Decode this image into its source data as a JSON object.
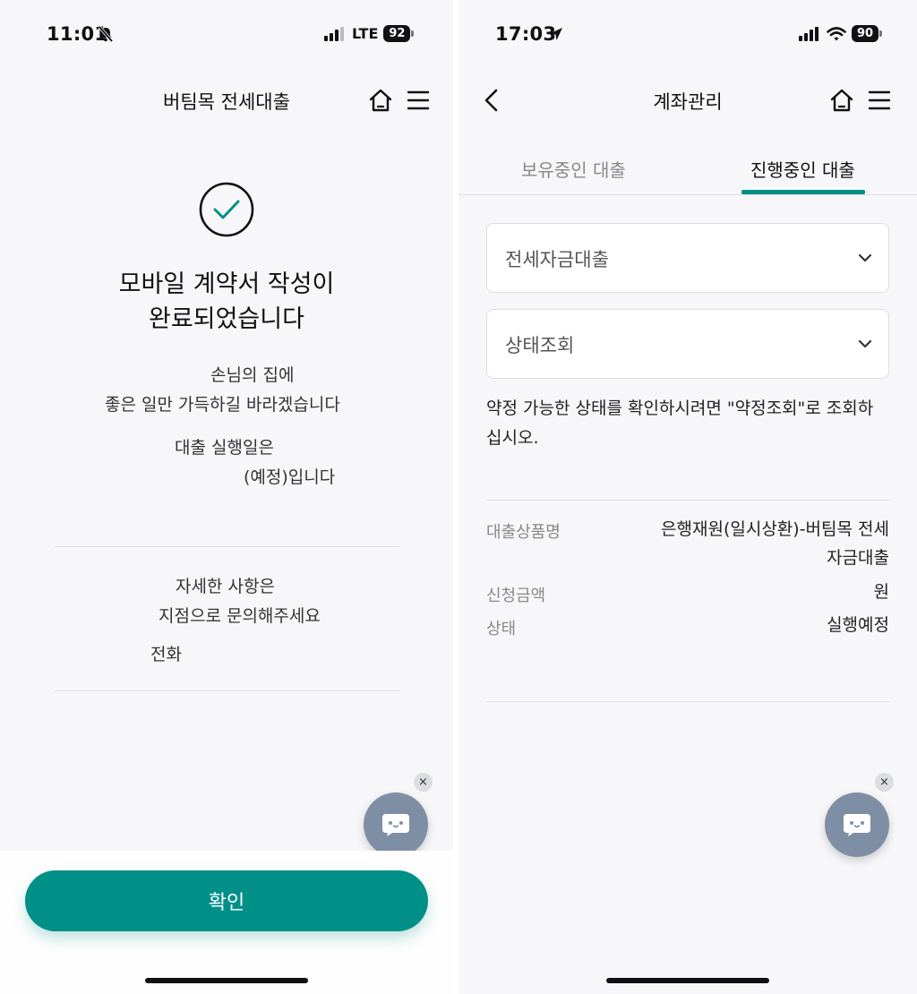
{
  "left": {
    "status": {
      "time": "11:01",
      "network": "LTE",
      "battery": "92"
    },
    "header": {
      "title": "버팀목 전세대출"
    },
    "title_line1": "모바일 계약서 작성이",
    "title_line2": "완료되었습니다",
    "greeting_line1": "손님의 집에",
    "greeting_line2": "좋은 일만 가득하길 바라겠습니다",
    "exec_line1": "대출 실행일은",
    "exec_line2": "(예정)입니다",
    "detail_line1": "자세한 사항은",
    "detail_line2": "지점으로 문의해주세요",
    "phone_label": "전화",
    "close_badge": "×",
    "confirm_label": "확인"
  },
  "right": {
    "status": {
      "time": "17:03",
      "battery": "90"
    },
    "header": {
      "title": "계좌관리"
    },
    "tabs": [
      {
        "label": "보유중인 대출",
        "active": false
      },
      {
        "label": "진행중인 대출",
        "active": true
      }
    ],
    "select_loan_type": "전세자금대출",
    "select_status": "상태조회",
    "notice_line1": "약정 가능한 상태를 확인하시려면 \"약정조회\"로 조회하",
    "notice_line2": "십시오.",
    "details": {
      "product_label": "대출상품명",
      "product_value_line1": "은행재원(일시상환)-버팀목 전세",
      "product_value_line2": "자금대출",
      "amount_label": "신청금액",
      "amount_value": "원",
      "status_label": "상태",
      "status_value": "실행예정"
    },
    "close_badge": "×"
  },
  "colors": {
    "accent": "#009087",
    "chat_fab": "#7e8fa5",
    "background": "#f7f7f9"
  },
  "icons": [
    "bell-slash-icon",
    "signal-icon",
    "battery-icon",
    "location-arrow-icon",
    "wifi-icon",
    "home-icon",
    "menu-icon",
    "back-arrow-icon",
    "check-circle-icon",
    "chevron-down-icon",
    "chat-bot-icon",
    "close-icon"
  ]
}
